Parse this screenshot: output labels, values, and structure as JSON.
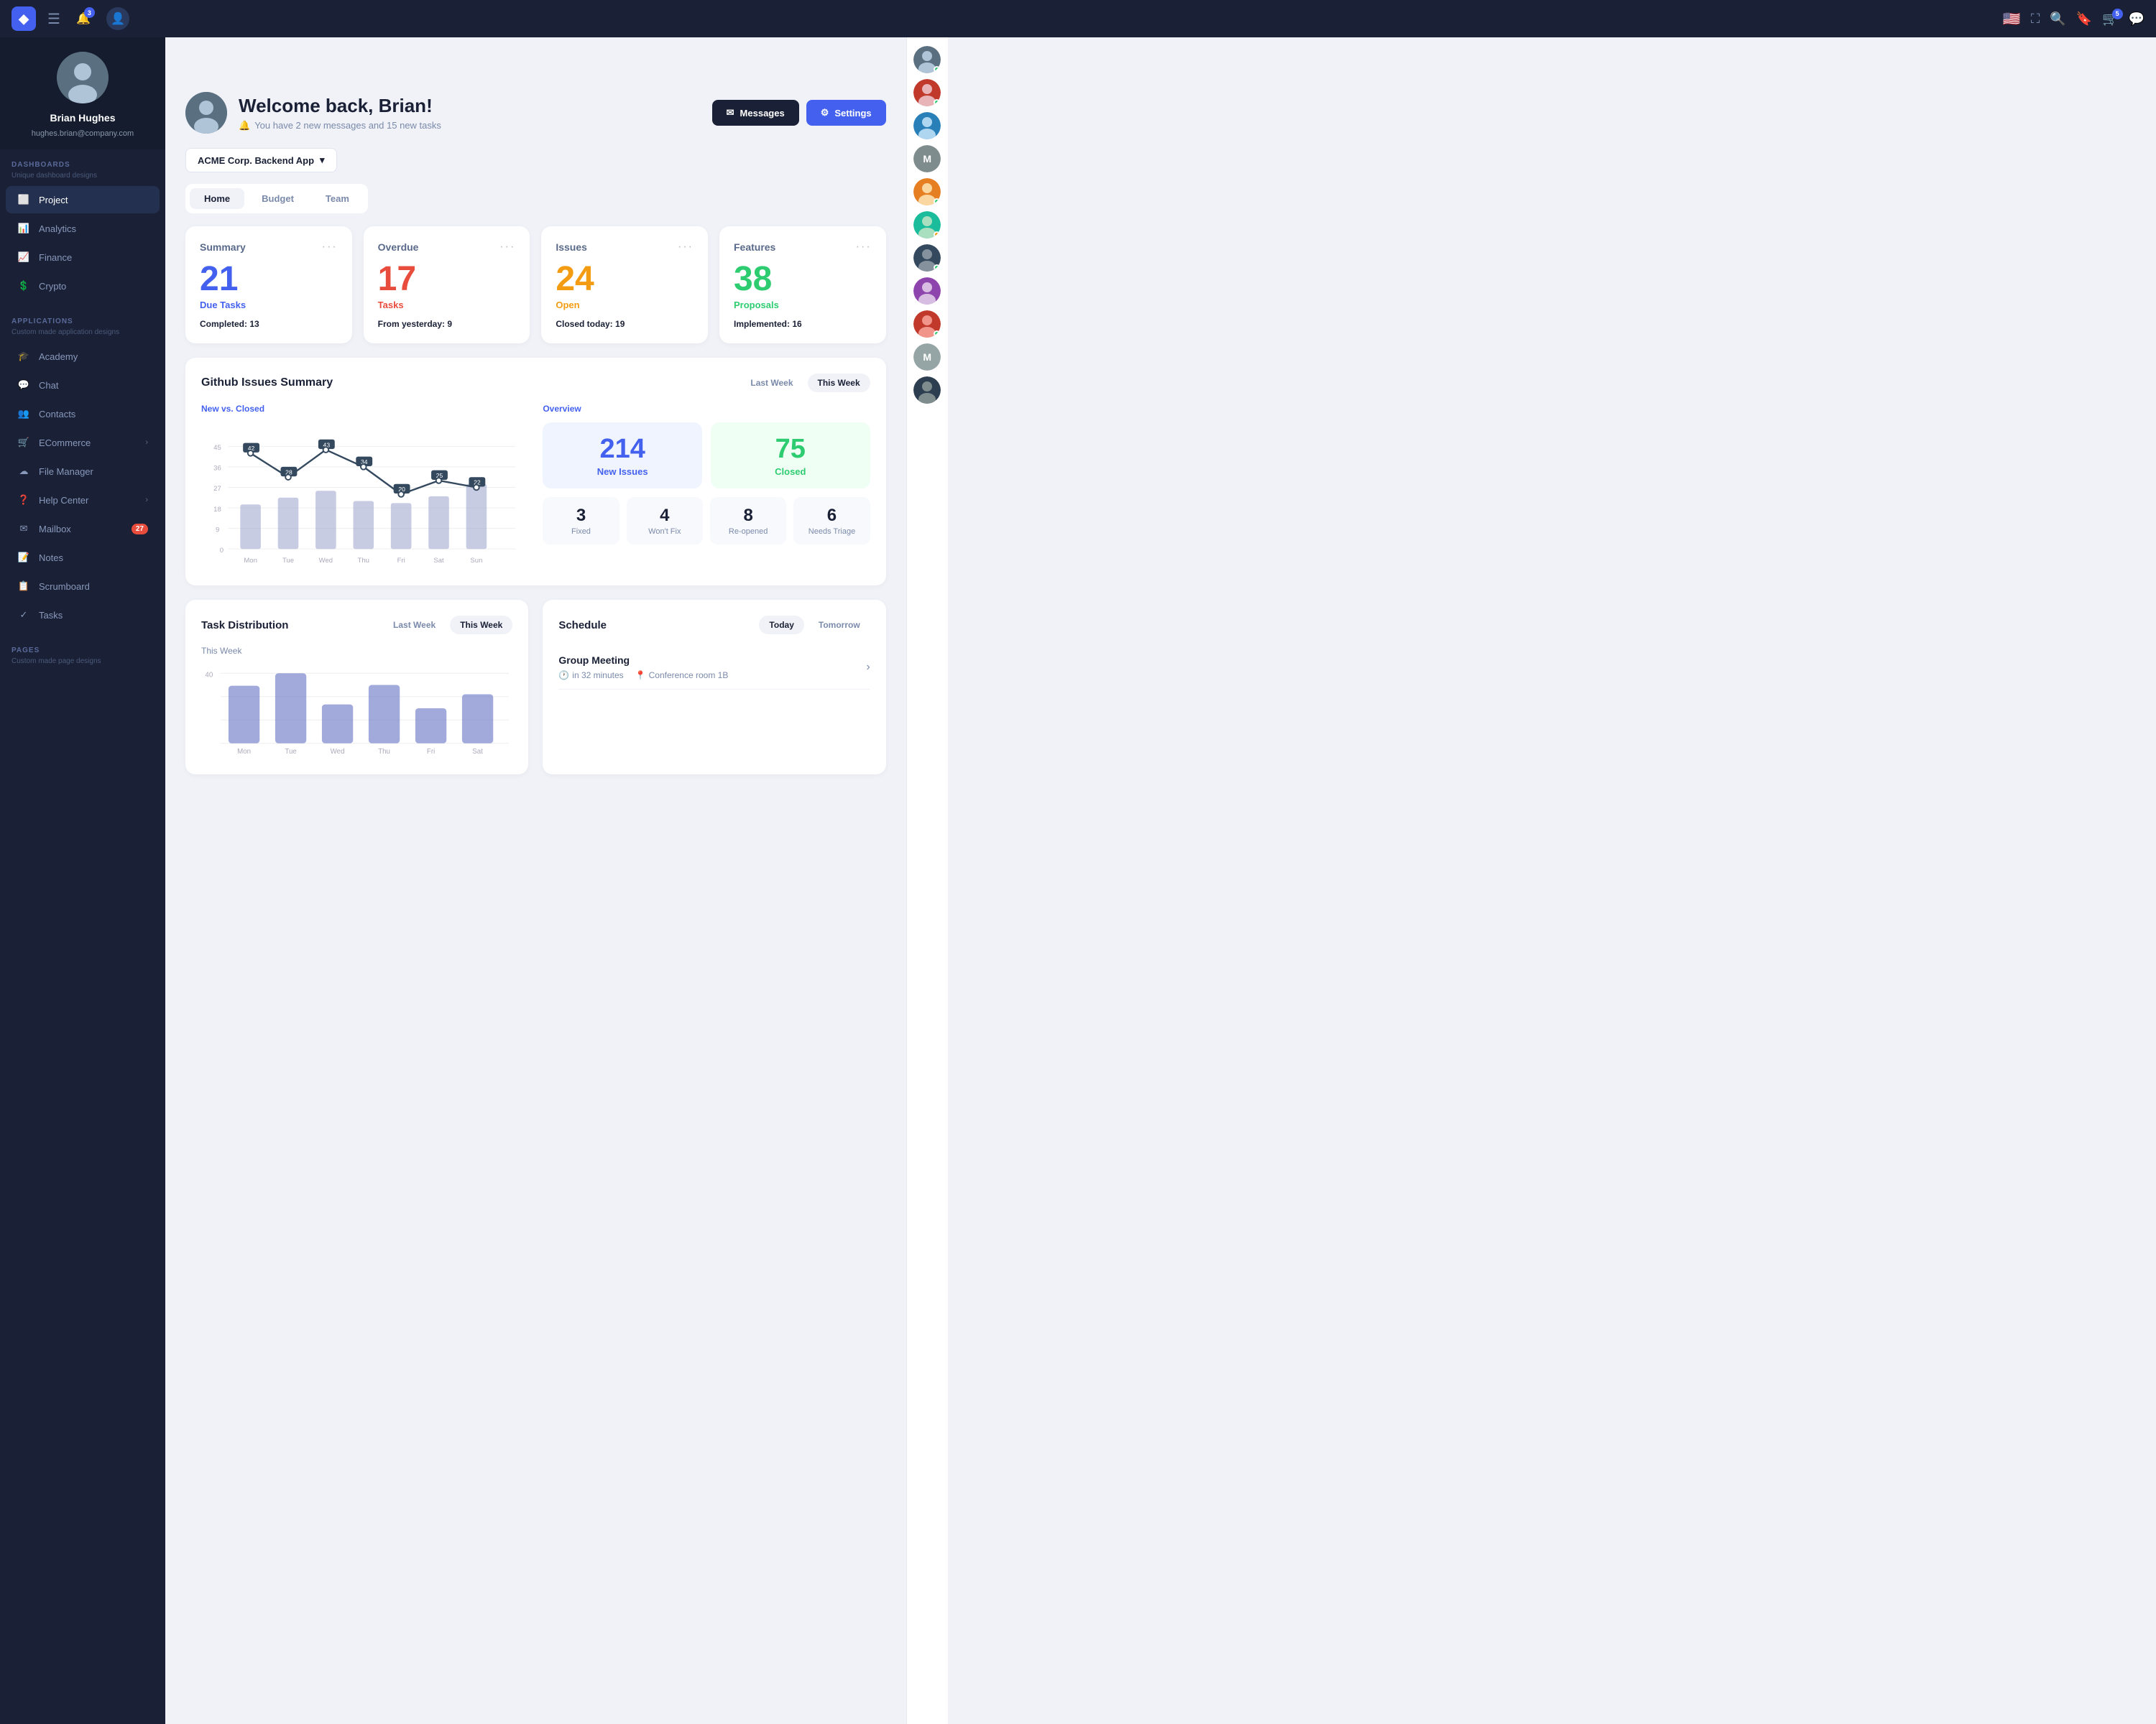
{
  "app": {
    "logo": "◆",
    "topnav": {
      "bell_badge": "3",
      "cart_badge": "5",
      "menu_icon": "☰"
    }
  },
  "sidebar": {
    "user": {
      "name": "Brian Hughes",
      "email": "hughes.brian@company.com"
    },
    "dashboards_label": "DASHBOARDS",
    "dashboards_sub": "Unique dashboard designs",
    "nav_items": [
      {
        "id": "project",
        "label": "Project",
        "active": true
      },
      {
        "id": "analytics",
        "label": "Analytics",
        "active": false
      },
      {
        "id": "finance",
        "label": "Finance",
        "active": false
      },
      {
        "id": "crypto",
        "label": "Crypto",
        "active": false
      }
    ],
    "applications_label": "APPLICATIONS",
    "applications_sub": "Custom made application designs",
    "app_items": [
      {
        "id": "academy",
        "label": "Academy",
        "badge": null
      },
      {
        "id": "chat",
        "label": "Chat",
        "badge": null
      },
      {
        "id": "contacts",
        "label": "Contacts",
        "badge": null
      },
      {
        "id": "ecommerce",
        "label": "ECommerce",
        "badge": null,
        "arrow": true
      },
      {
        "id": "filemanager",
        "label": "File Manager",
        "badge": null
      },
      {
        "id": "helpcenter",
        "label": "Help Center",
        "badge": null,
        "arrow": true
      },
      {
        "id": "mailbox",
        "label": "Mailbox",
        "badge": "27"
      },
      {
        "id": "notes",
        "label": "Notes",
        "badge": null
      },
      {
        "id": "scrumboard",
        "label": "Scrumboard",
        "badge": null
      },
      {
        "id": "tasks",
        "label": "Tasks",
        "badge": null
      }
    ],
    "pages_label": "PAGES",
    "pages_sub": "Custom made page designs"
  },
  "header": {
    "welcome": "Welcome back, Brian!",
    "subtitle": "You have 2 new messages and 15 new tasks",
    "messages_btn": "Messages",
    "settings_btn": "Settings"
  },
  "project_selector": {
    "label": "ACME Corp. Backend App"
  },
  "tabs": [
    {
      "id": "home",
      "label": "Home",
      "active": true
    },
    {
      "id": "budget",
      "label": "Budget",
      "active": false
    },
    {
      "id": "team",
      "label": "Team",
      "active": false
    }
  ],
  "stat_cards": [
    {
      "id": "summary",
      "title": "Summary",
      "number": "21",
      "color": "blue",
      "sublabel": "Due Tasks",
      "meta_label": "Completed:",
      "meta_value": "13"
    },
    {
      "id": "overdue",
      "title": "Overdue",
      "number": "17",
      "color": "red",
      "sublabel": "Tasks",
      "meta_label": "From yesterday:",
      "meta_value": "9"
    },
    {
      "id": "issues",
      "title": "Issues",
      "number": "24",
      "color": "orange",
      "sublabel": "Open",
      "meta_label": "Closed today:",
      "meta_value": "19"
    },
    {
      "id": "features",
      "title": "Features",
      "number": "38",
      "color": "green",
      "sublabel": "Proposals",
      "meta_label": "Implemented:",
      "meta_value": "16"
    }
  ],
  "github_issues": {
    "title": "Github Issues Summary",
    "last_week_btn": "Last Week",
    "this_week_btn": "This Week",
    "chart_subtitle": "New vs. Closed",
    "chart_data": {
      "labels": [
        "Mon",
        "Tue",
        "Wed",
        "Thu",
        "Fri",
        "Sat",
        "Sun"
      ],
      "line_values": [
        42,
        28,
        43,
        34,
        20,
        25,
        22
      ],
      "bar_heights": [
        60,
        55,
        70,
        50,
        45,
        55,
        80
      ],
      "y_labels": [
        "0",
        "9",
        "18",
        "27",
        "36",
        "45"
      ]
    },
    "overview_title": "Overview",
    "new_issues": "214",
    "new_issues_label": "New Issues",
    "closed": "75",
    "closed_label": "Closed",
    "small_stats": [
      {
        "num": "3",
        "label": "Fixed"
      },
      {
        "num": "4",
        "label": "Won't Fix"
      },
      {
        "num": "8",
        "label": "Re-opened"
      },
      {
        "num": "6",
        "label": "Needs Triage"
      }
    ]
  },
  "task_distribution": {
    "title": "Task Distribution",
    "last_week_btn": "Last Week",
    "this_week_btn": "This Week",
    "this_week_label": "This Week",
    "y_max": 40,
    "bars": [
      {
        "label": "Mon",
        "value": 28,
        "color": "#7986cb"
      },
      {
        "label": "Tue",
        "value": 35,
        "color": "#7986cb"
      },
      {
        "label": "Wed",
        "value": 20,
        "color": "#7986cb"
      },
      {
        "label": "Thu",
        "value": 30,
        "color": "#7986cb"
      },
      {
        "label": "Fri",
        "value": 18,
        "color": "#7986cb"
      },
      {
        "label": "Sat",
        "value": 25,
        "color": "#7986cb"
      }
    ]
  },
  "schedule": {
    "title": "Schedule",
    "today_btn": "Today",
    "tomorrow_btn": "Tomorrow",
    "items": [
      {
        "title": "Group Meeting",
        "time": "in 32 minutes",
        "location": "Conference room 1B"
      }
    ]
  },
  "right_sidebar": {
    "avatars": [
      {
        "id": "a1",
        "color": "#5a6a8a",
        "initials": "",
        "online": true
      },
      {
        "id": "a2",
        "color": "#e74c3c",
        "initials": "",
        "online": true
      },
      {
        "id": "a3",
        "color": "#3498db",
        "initials": "",
        "online": false
      },
      {
        "id": "a4",
        "color": "#9b59b6",
        "initials": "",
        "orange": true
      },
      {
        "id": "a5",
        "color": "#e67e22",
        "initials": "",
        "online": true
      },
      {
        "id": "a6",
        "color": "#1abc9c",
        "initials": "",
        "online": false
      },
      {
        "id": "a7",
        "color": "#34495e",
        "initials": "",
        "online": true
      },
      {
        "id": "a8",
        "color": "#c0392b",
        "initials": "",
        "online": false
      },
      {
        "id": "a9",
        "color": "#8e44ad",
        "initials": "M",
        "online": false
      },
      {
        "id": "a10",
        "color": "#d35400",
        "initials": "",
        "online": true
      },
      {
        "id": "a11",
        "color": "#2980b9",
        "initials": "M",
        "online": false
      },
      {
        "id": "a12",
        "color": "#27ae60",
        "initials": "",
        "online": true
      }
    ]
  }
}
